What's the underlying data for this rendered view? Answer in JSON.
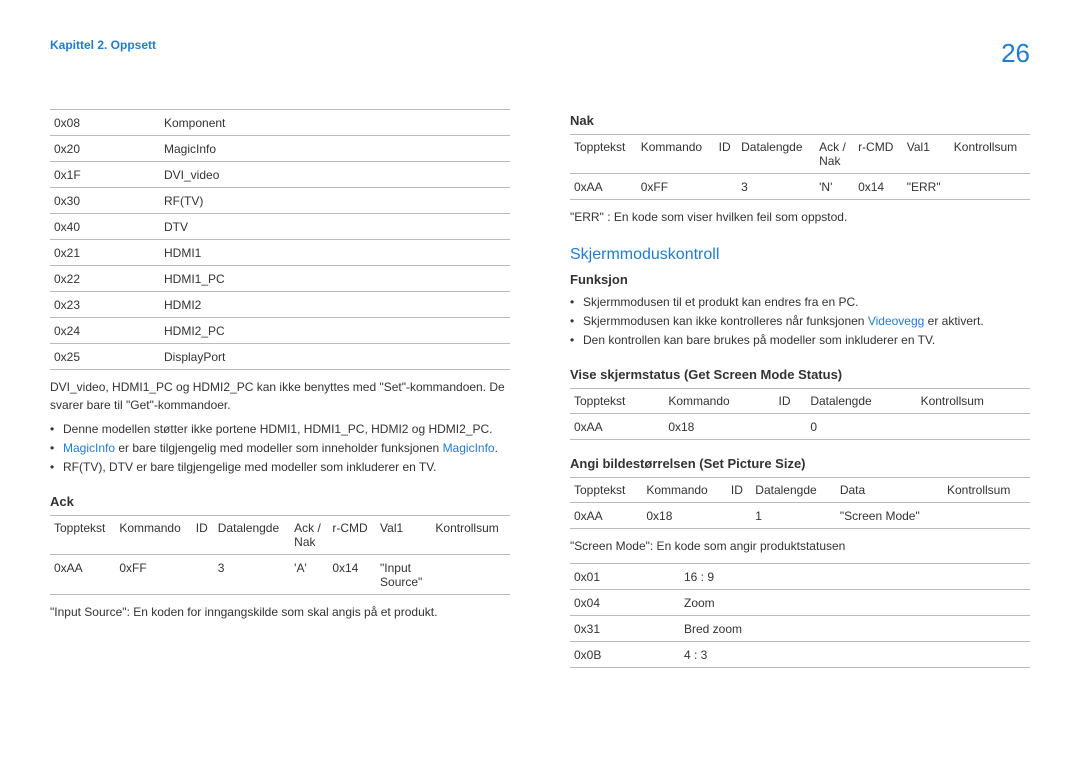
{
  "header": {
    "chapter": "Kapittel 2. Oppsett",
    "page": "26"
  },
  "left": {
    "kv_rows": [
      [
        "0x08",
        "Komponent"
      ],
      [
        "0x20",
        "MagicInfo"
      ],
      [
        "0x1F",
        "DVI_video"
      ],
      [
        "0x30",
        "RF(TV)"
      ],
      [
        "0x40",
        "DTV"
      ],
      [
        "0x21",
        "HDMI1"
      ],
      [
        "0x22",
        "HDMI1_PC"
      ],
      [
        "0x23",
        "HDMI2"
      ],
      [
        "0x24",
        "HDMI2_PC"
      ],
      [
        "0x25",
        "DisplayPort"
      ]
    ],
    "note1a": "DVI_video, HDMI1_PC og HDMI2_PC kan ikke benyttes med \"Set\"-kommandoen. De svarer bare til \"Get\"-kommandoer.",
    "bullet1": "Denne modellen støtter ikke portene HDMI1, HDMI1_PC, HDMI2 og HDMI2_PC.",
    "bullet2_link1": "MagicInfo",
    "bullet2_mid": " er bare tilgjengelig med modeller som inneholder funksjonen ",
    "bullet2_link2": "MagicInfo",
    "bullet2_end": ".",
    "bullet3": "RF(TV), DTV er bare tilgjengelige med modeller som inkluderer en TV.",
    "ack_heading": "Ack",
    "ack_headers": [
      "Topptekst",
      "Kommando",
      "ID",
      "Datalengde",
      "Ack / Nak",
      "r-CMD",
      "Val1",
      "Kontrollsum"
    ],
    "ack_row": [
      "0xAA",
      "0xFF",
      "",
      "3",
      "'A'",
      "0x14",
      "\"Input Source\"",
      ""
    ],
    "input_source_note": "\"Input Source\": En koden for inngangskilde som skal angis på et produkt."
  },
  "right": {
    "nak_heading": "Nak",
    "nak_headers": [
      "Topptekst",
      "Kommando",
      "ID",
      "Datalengde",
      "Ack / Nak",
      "r-CMD",
      "Val1",
      "Kontrollsum"
    ],
    "nak_row": [
      "0xAA",
      "0xFF",
      "",
      "3",
      "'N'",
      "0x14",
      "\"ERR\"",
      ""
    ],
    "err_note": "\"ERR\" : En kode som viser hvilken feil som oppstod.",
    "blue_heading": "Skjermmoduskontroll",
    "funksjon_heading": "Funksjon",
    "funk_b1": "Skjermmodusen til et produkt kan endres fra en PC.",
    "funk_b2a": "Skjermmodusen kan ikke kontrolleres når funksjonen ",
    "funk_b2_link": "Videovegg",
    "funk_b2b": " er aktivert.",
    "funk_b3": "Den kontrollen kan bare brukes på modeller som inkluderer en TV.",
    "vise_heading": "Vise skjermstatus (Get Screen Mode Status)",
    "vise_headers": [
      "Topptekst",
      "Kommando",
      "ID",
      "Datalengde",
      "Kontrollsum"
    ],
    "vise_row": [
      "0xAA",
      "0x18",
      "",
      "0",
      ""
    ],
    "angi_heading": "Angi bildestørrelsen (Set Picture Size)",
    "angi_headers": [
      "Topptekst",
      "Kommando",
      "ID",
      "Datalengde",
      "Data",
      "Kontrollsum"
    ],
    "angi_row": [
      "0xAA",
      "0x18",
      "",
      "1",
      "\"Screen Mode\"",
      ""
    ],
    "screen_mode_note": "\"Screen Mode\": En kode som angir produktstatusen",
    "sm_rows": [
      [
        "0x01",
        "16 : 9"
      ],
      [
        "0x04",
        "Zoom"
      ],
      [
        "0x31",
        "Bred zoom"
      ],
      [
        "0x0B",
        "4 : 3"
      ]
    ]
  }
}
